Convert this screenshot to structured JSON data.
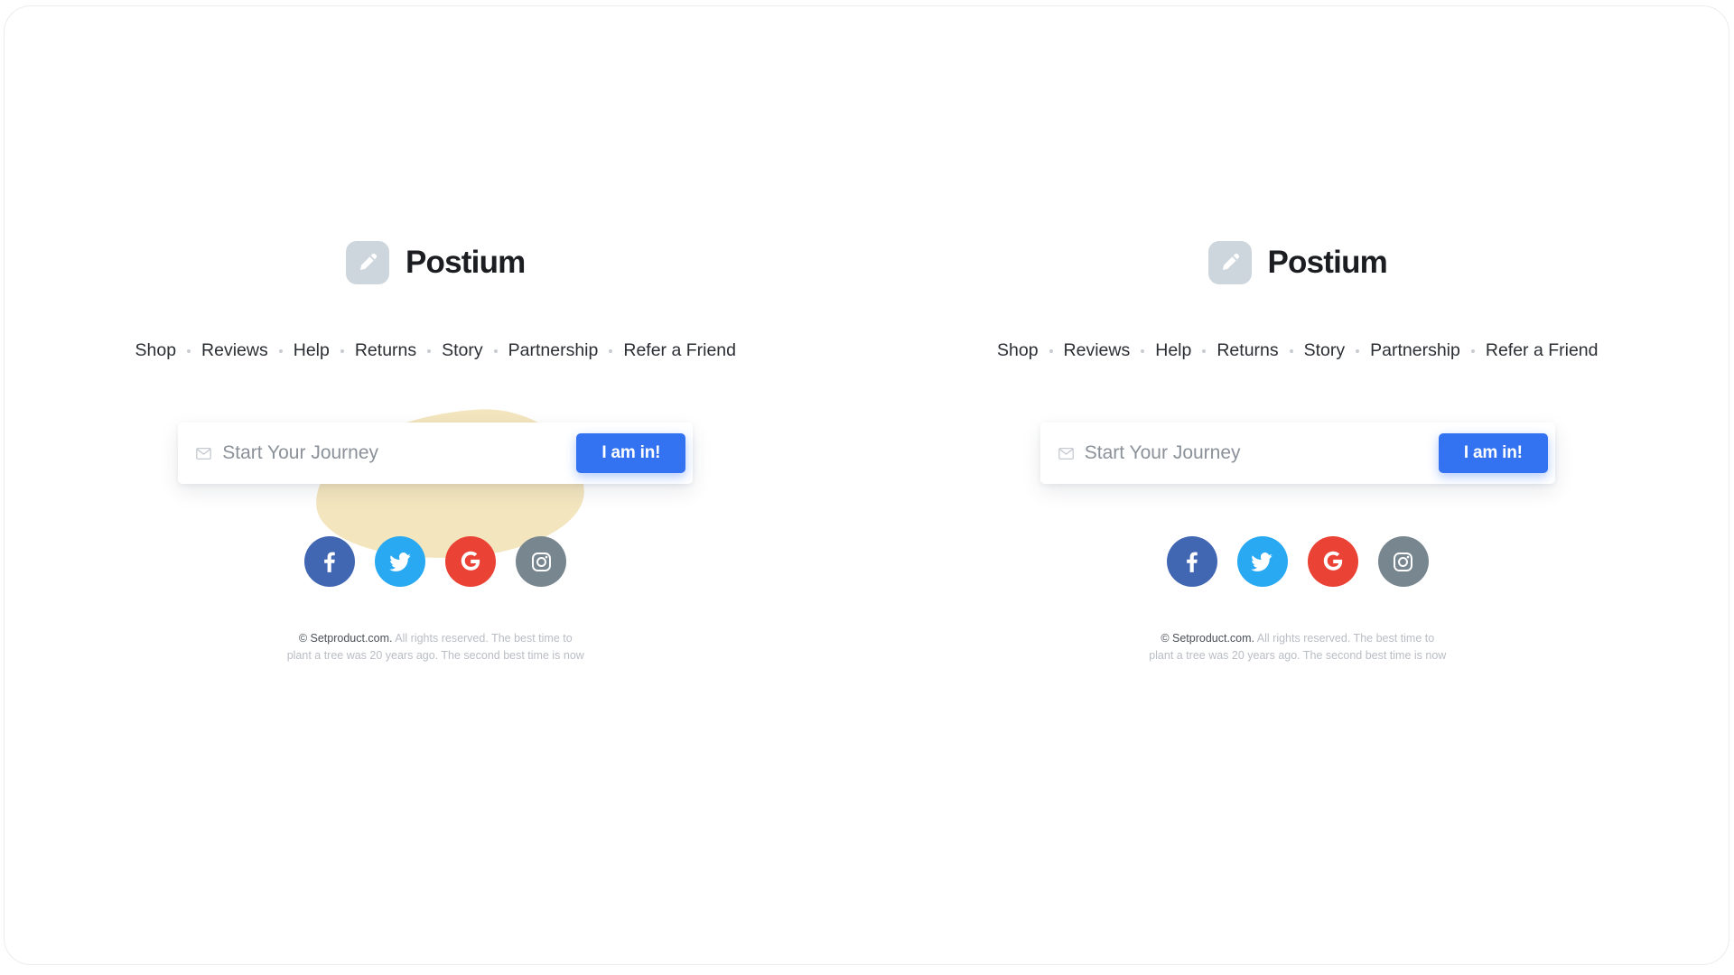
{
  "brand": {
    "name": "Postium",
    "logo_icon": "pencil-icon",
    "logo_box_color": "#cdd6dc"
  },
  "nav": {
    "items": [
      {
        "label": "Shop"
      },
      {
        "label": "Reviews"
      },
      {
        "label": "Help"
      },
      {
        "label": "Returns"
      },
      {
        "label": "Story"
      },
      {
        "label": "Partnership"
      },
      {
        "label": "Refer a Friend"
      }
    ]
  },
  "subscribe": {
    "icon": "envelope-icon",
    "placeholder": "Start Your Journey",
    "value": "",
    "button_label": "I am in!",
    "button_color": "#3372f0"
  },
  "socials": [
    {
      "name": "facebook",
      "label": "Facebook",
      "color": "#4267b2"
    },
    {
      "name": "twitter",
      "label": "Twitter",
      "color": "#29a9f2"
    },
    {
      "name": "google",
      "label": "Google",
      "color": "#ea4335"
    },
    {
      "name": "instagram",
      "label": "Instagram",
      "color": "#78868f"
    }
  ],
  "copyright": {
    "brand": "© Setproduct.com.",
    "text": " All rights reserved. The best time to plant a tree was 20 years ago. The second best time is now"
  },
  "decoration": {
    "blob_color": "#f3e5be"
  }
}
